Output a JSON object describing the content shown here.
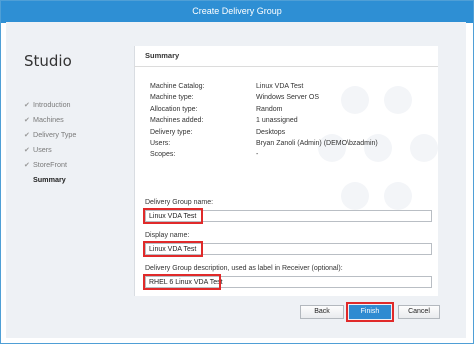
{
  "window": {
    "title": "Create Delivery Group"
  },
  "sidebar": {
    "app_title": "Studio",
    "steps": [
      {
        "label": "Introduction",
        "done": true
      },
      {
        "label": "Machines",
        "done": true
      },
      {
        "label": "Delivery Type",
        "done": true
      },
      {
        "label": "Users",
        "done": true
      },
      {
        "label": "StoreFront",
        "done": true
      },
      {
        "label": "Summary",
        "done": false,
        "active": true
      }
    ]
  },
  "summary": {
    "heading": "Summary",
    "rows": [
      {
        "key": "Machine Catalog:",
        "value": "Linux VDA Test"
      },
      {
        "key": "Machine type:",
        "value": "Windows Server OS"
      },
      {
        "key": "Allocation type:",
        "value": "Random"
      },
      {
        "key": "Machines added:",
        "value": "1 unassigned"
      },
      {
        "key": "Delivery type:",
        "value": "Desktops"
      },
      {
        "key": "Users:",
        "value": "Bryan Zanoli (Admin) (DEMO\\bzadmin)"
      },
      {
        "key": "Scopes:",
        "value": "-"
      }
    ]
  },
  "form": {
    "group_name_label": "Delivery Group name:",
    "group_name_value": "Linux VDA Test",
    "display_name_label": "Display name:",
    "display_name_value": "Linux VDA Test",
    "description_label": "Delivery Group description, used as label in Receiver (optional):",
    "description_value": "RHEL 6 Linux VDA Test"
  },
  "buttons": {
    "back": "Back",
    "finish": "Finish",
    "cancel": "Cancel"
  },
  "colors": {
    "titlebar": "#2e8fd4",
    "primary_button": "#2f8bd1",
    "highlight": "#e02a2a"
  }
}
